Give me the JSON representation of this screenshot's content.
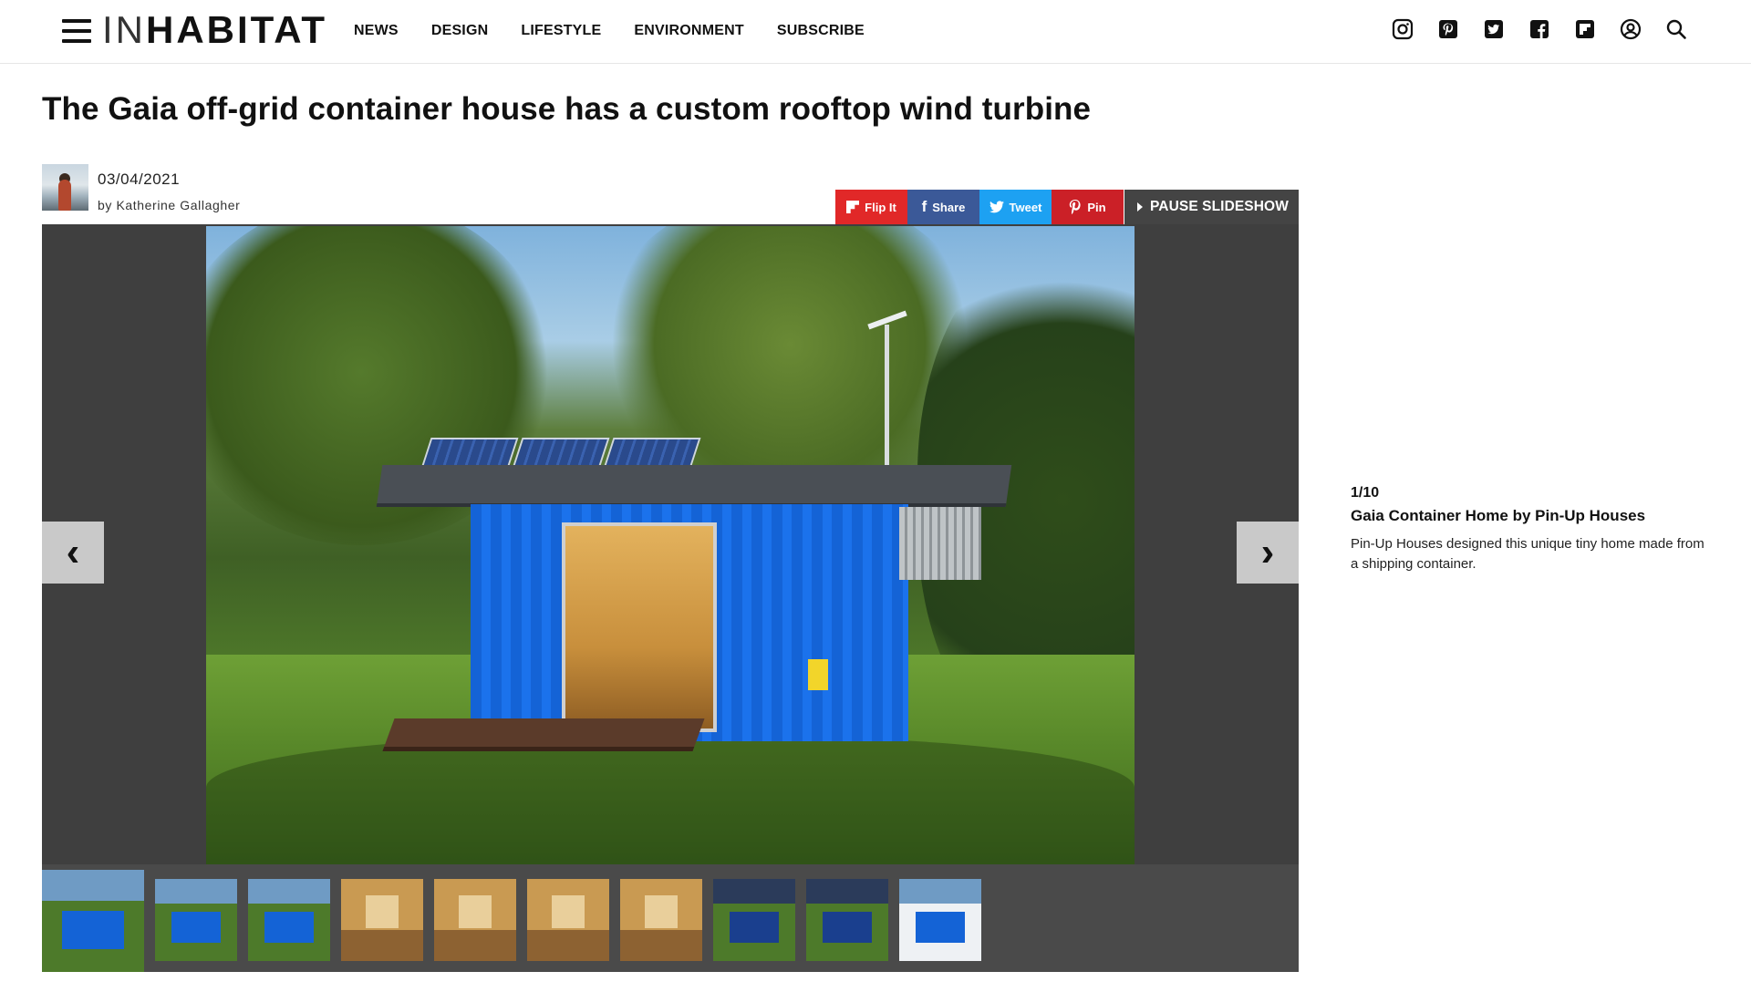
{
  "header": {
    "logo_in": "IN",
    "logo_habitat": "HABITAT",
    "nav": [
      "NEWS",
      "DESIGN",
      "LIFESTYLE",
      "ENVIRONMENT",
      "SUBSCRIBE"
    ],
    "social_icons": [
      "instagram-icon",
      "pinterest-icon",
      "twitter-icon",
      "facebook-icon",
      "flipboard-icon",
      "user-account-icon",
      "search-icon"
    ]
  },
  "article": {
    "title": "The Gaia off-grid container house has a custom rooftop wind turbine",
    "date": "03/04/2021",
    "byline": "by Katherine Gallagher"
  },
  "share": {
    "flip": "Flip It",
    "facebook": "Share",
    "twitter": "Tweet",
    "pinterest": "Pin",
    "pause": "PAUSE SLIDESHOW"
  },
  "slideshow": {
    "prev_glyph": "‹",
    "next_glyph": "›",
    "counter": "1/10",
    "caption_title": "Gaia Container Home by Pin-Up Houses",
    "caption_text": "Pin-Up Houses designed this unique tiny home made from a shipping container.",
    "thumbnail_count": 10
  },
  "colors": {
    "flipboard": "#e12828",
    "facebook": "#3b5998",
    "twitter": "#1da1f2",
    "pinterest": "#cb2027",
    "stage": "#3f3f3f",
    "container_blue": "#1463d6"
  }
}
